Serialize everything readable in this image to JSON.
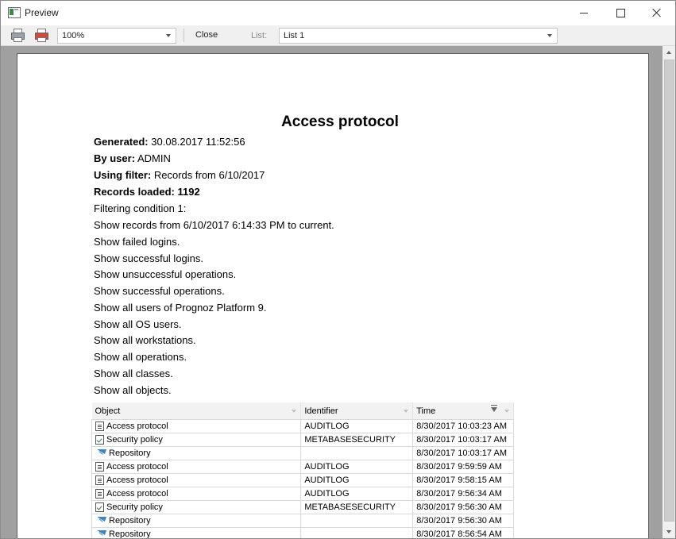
{
  "window": {
    "title": "Preview"
  },
  "toolbar": {
    "zoom_value": "100%",
    "close_label": "Close",
    "list_label": "List:",
    "list_value": "List 1"
  },
  "report": {
    "title": "Access protocol",
    "generated_label": "Generated:",
    "generated_value": "30.08.2017 11:52:56",
    "user_label": "By user:",
    "user_value": "ADMIN",
    "filter_label": "Using filter:",
    "filter_value": "Records from 6/10/2017",
    "records_label": "Records loaded:",
    "records_value": "1192",
    "filter_lines": [
      "Filtering condition 1:",
      "Show records from 6/10/2017 6:14:33 PM to current.",
      "Show failed logins.",
      "Show successful logins.",
      "Show unsuccessful operations.",
      "Show successful operations.",
      "Show all users of Prognoz Platform 9.",
      "Show all OS users.",
      "Show all workstations.",
      "Show all operations.",
      "Show all classes.",
      "Show all objects."
    ],
    "table": {
      "columns": [
        "Object",
        "Identifier",
        "Time"
      ],
      "rows": [
        {
          "icon": "document-icon",
          "object": "Access protocol",
          "identifier": "AUDITLOG",
          "time": "8/30/2017 10:03:23 AM"
        },
        {
          "icon": "policy-icon",
          "object": "Security policy",
          "identifier": "METABASESECURITY",
          "time": "8/30/2017 10:03:17 AM"
        },
        {
          "icon": "repository-icon",
          "object": "Repository",
          "identifier": "",
          "time": "8/30/2017 10:03:17 AM"
        },
        {
          "icon": "document-icon",
          "object": "Access protocol",
          "identifier": "AUDITLOG",
          "time": "8/30/2017 9:59:59 AM"
        },
        {
          "icon": "document-icon",
          "object": "Access protocol",
          "identifier": "AUDITLOG",
          "time": "8/30/2017 9:58:15 AM"
        },
        {
          "icon": "document-icon",
          "object": "Access protocol",
          "identifier": "AUDITLOG",
          "time": "8/30/2017 9:56:34 AM"
        },
        {
          "icon": "policy-icon",
          "object": "Security policy",
          "identifier": "METABASESECURITY",
          "time": "8/30/2017 9:56:30 AM"
        },
        {
          "icon": "repository-icon",
          "object": "Repository",
          "identifier": "",
          "time": "8/30/2017 9:56:30 AM"
        },
        {
          "icon": "repository-icon",
          "object": "Repository",
          "identifier": "",
          "time": "8/30/2017 8:56:54 AM"
        }
      ]
    }
  }
}
